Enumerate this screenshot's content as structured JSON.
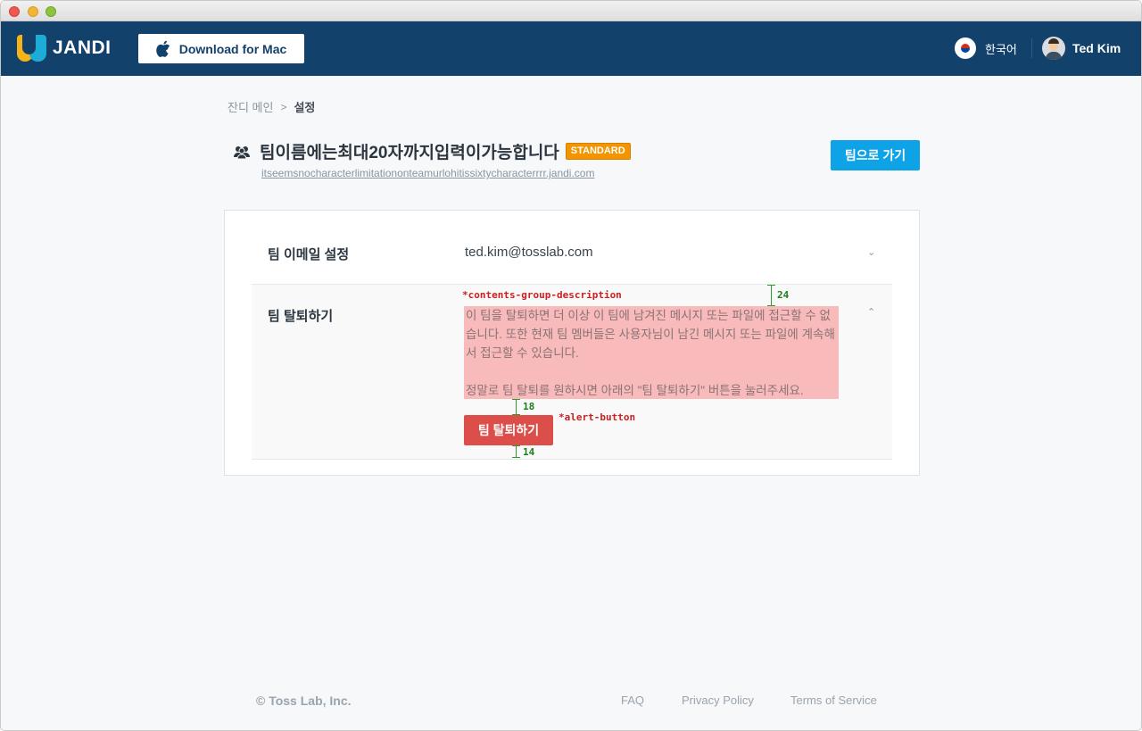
{
  "header": {
    "logo_text": "JANDI",
    "download_label": "Download for Mac",
    "language": "한국어",
    "user_name": "Ted Kim"
  },
  "breadcrumb": {
    "home": "잔디 메인",
    "separator": ">",
    "current": "설정"
  },
  "team": {
    "name": "팀이름에는최대20자까지입력이가능합니다",
    "plan_badge": "STANDARD",
    "url": "itseemsnocharacterlimitationonteamurlohitissixtycharacterrrr.jandi.com",
    "go_button": "팀으로 가기"
  },
  "settings": {
    "email_row": {
      "label": "팀 이메일 설정",
      "value": "ted.kim@tosslab.com",
      "chevron": "⌄"
    },
    "leave_row": {
      "label": "팀 탈퇴하기",
      "chevron": "⌃",
      "description_p1": "이 팀을 탈퇴하면 더 이상 이 팀에 남겨진 메시지 또는 파일에 접근할 수 없습니다. 또한 현재 팀 멤버들은 사용자님이 남긴 메시지 또는 파일에 계속해서 접근할 수 있습니다.",
      "description_p2": "정말로 팀 탈퇴를 원하시면 아래의 \"팀 탈퇴하기\" 버튼을 눌러주세요.",
      "button": "팀 탈퇴하기"
    }
  },
  "annotations": {
    "description_note": "*contents-group-description",
    "button_note": "*alert-button",
    "spacing_top": "24",
    "spacing_mid": "18",
    "spacing_bottom": "14"
  },
  "footer": {
    "copyright": "© Toss Lab, Inc.",
    "links": [
      "FAQ",
      "Privacy Policy",
      "Terms of Service"
    ]
  },
  "colors": {
    "nav_bg": "#12416b",
    "primary": "#0ea2e6",
    "alert": "#dc4e49",
    "badge": "#f29500",
    "highlight": "#f8babb"
  }
}
